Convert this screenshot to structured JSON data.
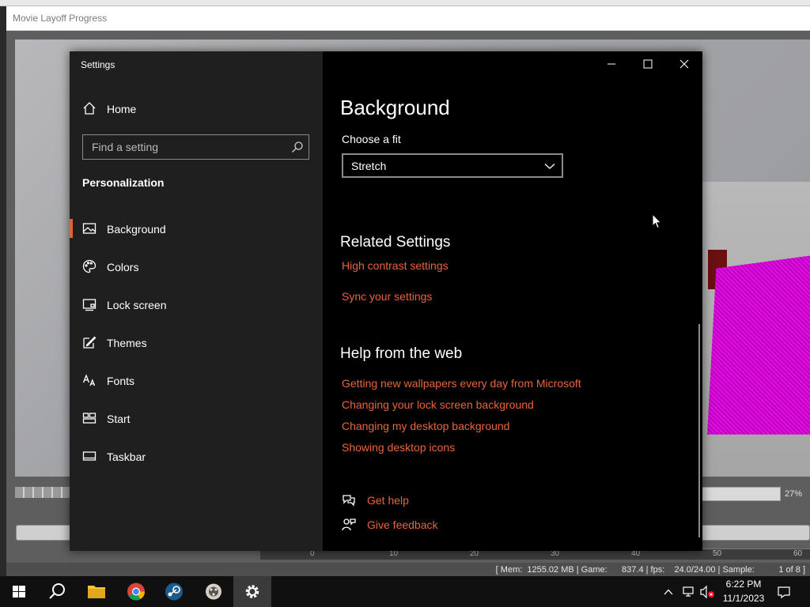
{
  "background_app": {
    "title": "Movie Layoff Progress",
    "zoom": "27%",
    "ruler_labels": [
      "0",
      "10",
      "20",
      "30",
      "40",
      "50",
      "60"
    ],
    "status": "[ Mem:  1255.02 MB | Game:      837.4 | fps:    24.0/24.00 | Sample:          1 of 8 ]"
  },
  "settings": {
    "window_title": "Settings",
    "home_label": "Home",
    "search": {
      "placeholder": "Find a setting"
    },
    "section_heading": "Personalization",
    "nav_items": [
      {
        "label": "Background",
        "icon": "picture-icon",
        "active": true
      },
      {
        "label": "Colors",
        "icon": "palette-icon"
      },
      {
        "label": "Lock screen",
        "icon": "lock-screen-icon"
      },
      {
        "label": "Themes",
        "icon": "themes-icon"
      },
      {
        "label": "Fonts",
        "icon": "fonts-icon"
      },
      {
        "label": "Start",
        "icon": "start-icon"
      },
      {
        "label": "Taskbar",
        "icon": "taskbar-icon"
      }
    ],
    "page_title": "Background",
    "fit": {
      "label": "Choose a fit",
      "selected": "Stretch"
    },
    "related": {
      "heading": "Related Settings",
      "links": [
        "High contrast settings",
        "Sync your settings"
      ]
    },
    "help_web": {
      "heading": "Help from the web",
      "links": [
        "Getting new wallpapers every day from Microsoft",
        "Changing your lock screen background",
        "Changing my desktop background",
        "Showing desktop icons"
      ]
    },
    "get_help": "Get help",
    "give_feedback": "Give feedback"
  },
  "taskbar": {
    "time": "6:22 PM",
    "date": "11/1/2023"
  },
  "colors": {
    "accent": "#e06234",
    "link": "#e8643c"
  }
}
